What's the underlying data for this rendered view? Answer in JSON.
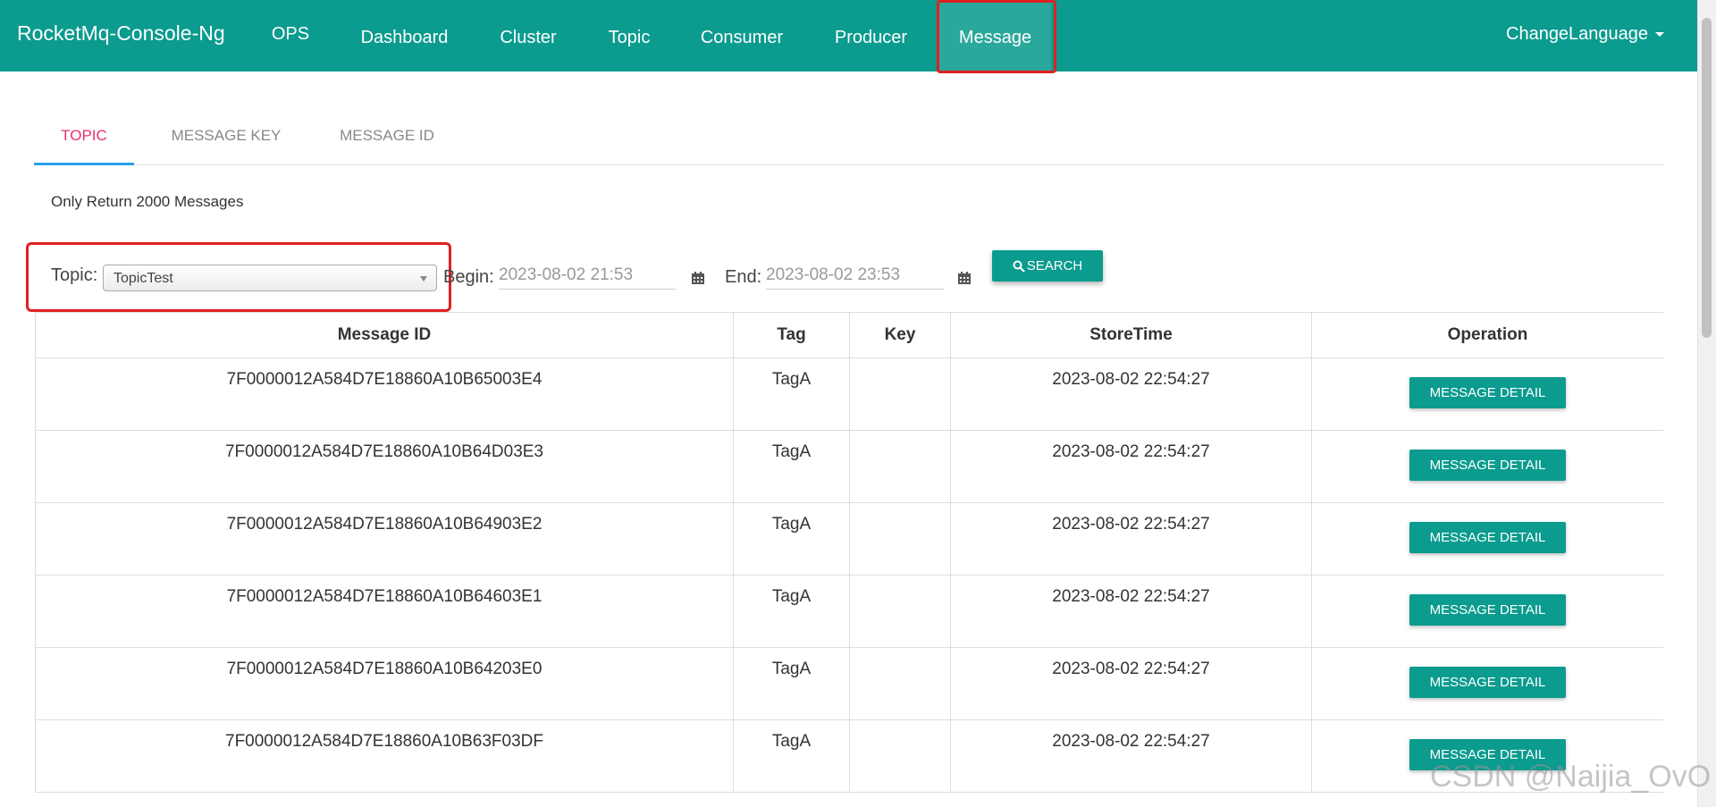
{
  "navbar": {
    "brand": "RocketMq-Console-Ng",
    "items": [
      {
        "label": "OPS"
      },
      {
        "label": "Dashboard"
      },
      {
        "label": "Cluster"
      },
      {
        "label": "Topic"
      },
      {
        "label": "Consumer"
      },
      {
        "label": "Producer"
      },
      {
        "label": "Message"
      }
    ],
    "active": "Message",
    "language_label": "ChangeLanguage",
    "bg_color": "#0b9b8f",
    "highlight_color": "#e02020"
  },
  "tabs": [
    {
      "label": "TOPIC"
    },
    {
      "label": "MESSAGE KEY"
    },
    {
      "label": "MESSAGE ID"
    }
  ],
  "notice": "Only Return 2000 Messages",
  "search": {
    "topic_label": "Topic:",
    "topic_value": "TopicTest",
    "begin_label": "Begin:",
    "begin_value": "2023-08-02 21:53",
    "end_label": "End:",
    "end_value": "2023-08-02 23:53",
    "search_label": "SEARCH"
  },
  "table": {
    "headers": [
      "Message ID",
      "Tag",
      "Key",
      "StoreTime",
      "Operation"
    ],
    "rows": [
      {
        "id": "7F0000012A584D7E18860A10B65003E4",
        "tag": "TagA",
        "key": "",
        "time": "2023-08-02 22:54:27",
        "action": "MESSAGE DETAIL"
      },
      {
        "id": "7F0000012A584D7E18860A10B64D03E3",
        "tag": "TagA",
        "key": "",
        "time": "2023-08-02 22:54:27",
        "action": "MESSAGE DETAIL"
      },
      {
        "id": "7F0000012A584D7E18860A10B64903E2",
        "tag": "TagA",
        "key": "",
        "time": "2023-08-02 22:54:27",
        "action": "MESSAGE DETAIL"
      },
      {
        "id": "7F0000012A584D7E18860A10B64603E1",
        "tag": "TagA",
        "key": "",
        "time": "2023-08-02 22:54:27",
        "action": "MESSAGE DETAIL"
      },
      {
        "id": "7F0000012A584D7E18860A10B64203E0",
        "tag": "TagA",
        "key": "",
        "time": "2023-08-02 22:54:27",
        "action": "MESSAGE DETAIL"
      },
      {
        "id": "7F0000012A584D7E18860A10B63F03DF",
        "tag": "TagA",
        "key": "",
        "time": "2023-08-02 22:54:27",
        "action": "MESSAGE DETAIL"
      }
    ]
  },
  "watermark": "CSDN @Naijia_OvO"
}
